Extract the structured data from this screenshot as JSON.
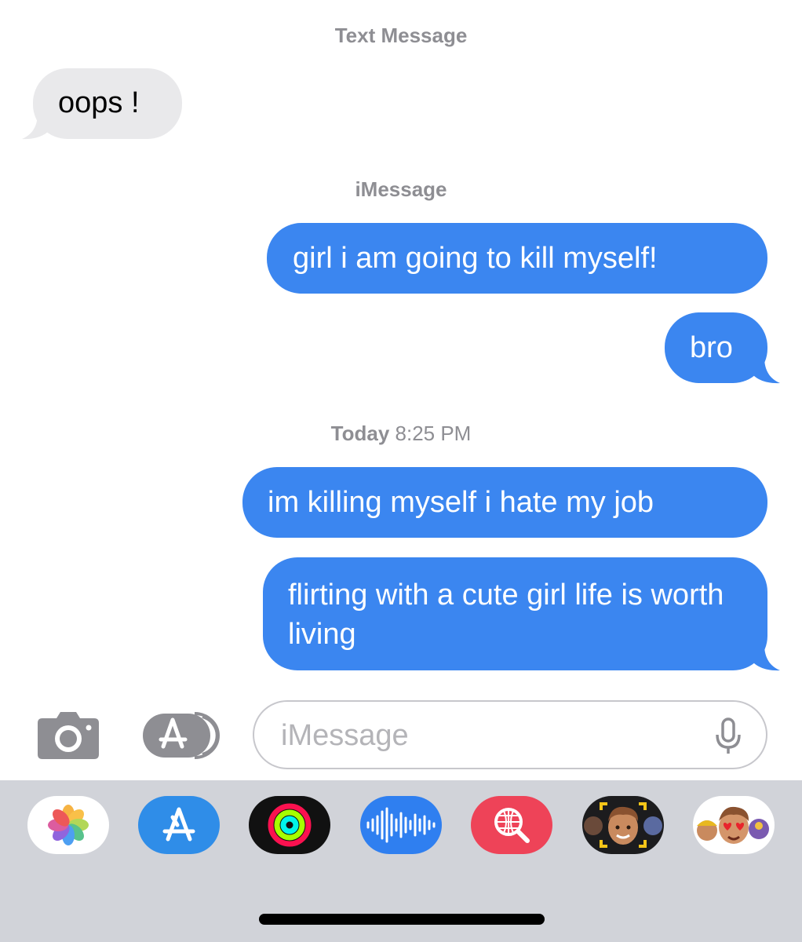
{
  "header": {
    "service_label": "Text Message"
  },
  "messages_block1": {
    "received": "oops !"
  },
  "imessage_label": "iMessage",
  "sent_block1": [
    "girl i am going to kill myself!",
    "bro"
  ],
  "timestamp": {
    "day": "Today",
    "time": "8:25 PM"
  },
  "sent_block2": [
    "im killing myself i hate my job",
    "flirting with a cute girl life is worth living"
  ],
  "composer": {
    "placeholder": "iMessage",
    "value": ""
  },
  "colors": {
    "sent_bubble": "#3b86f0",
    "received_bubble": "#e9e9eb",
    "tray": "#d1d3d9"
  },
  "toolbar_icons": [
    "camera-icon",
    "app-store-icon",
    "microphone-icon"
  ],
  "app_tray": [
    "photos-app",
    "app-store-app",
    "activity-app",
    "audio-message-app",
    "images-search-app",
    "memoji-camera-app",
    "memoji-stickers-app"
  ]
}
